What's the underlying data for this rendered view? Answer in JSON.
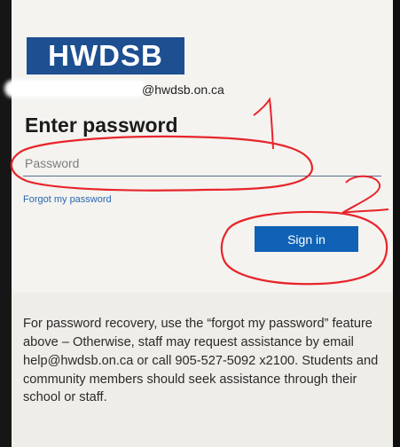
{
  "brand": {
    "logo_text": "HWDSB"
  },
  "signin": {
    "email_domain": "@hwdsb.on.ca",
    "title": "Enter password",
    "password_placeholder": "Password",
    "forgot_link": "Forgot my password",
    "signin_button": "Sign in"
  },
  "help": {
    "text": "For password recovery, use the “forgot my password” feature above – Otherwise, staff may request assistance by email help@hwdsb.on.ca or call 905-527-5092 x2100. Students and community members should seek assistance through their school or staff."
  },
  "annotations": {
    "marker_1": "1",
    "marker_2": "2",
    "color": "#e8242b"
  }
}
